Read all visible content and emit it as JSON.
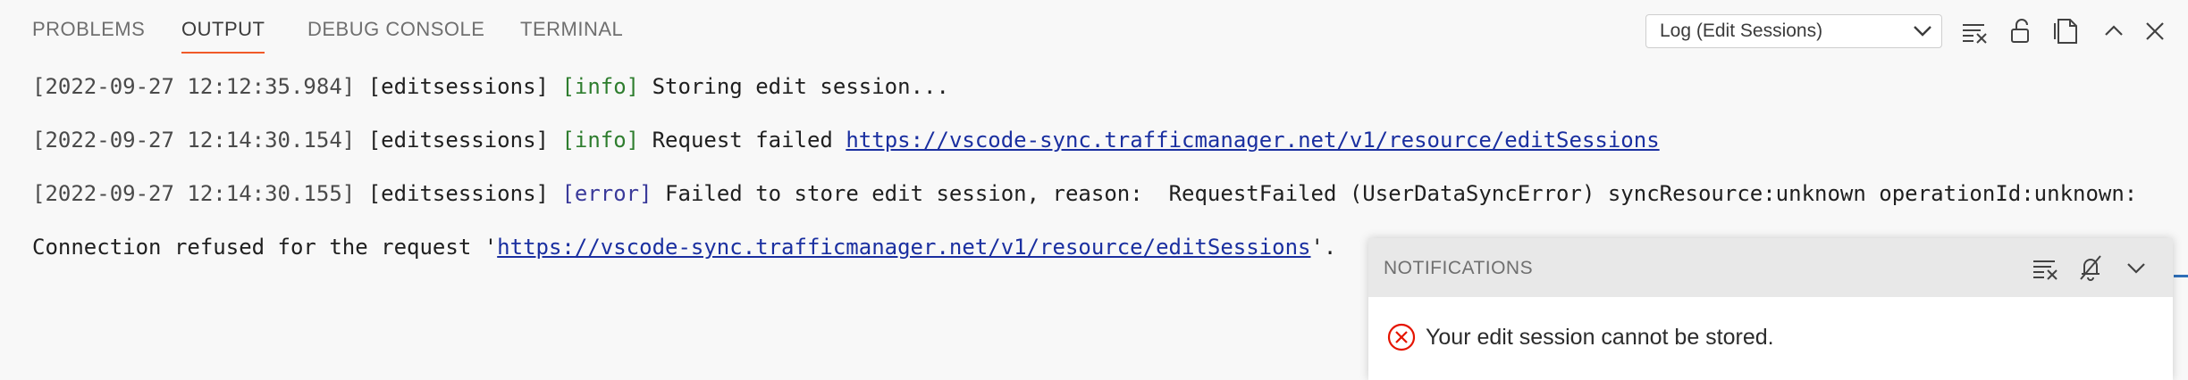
{
  "tabs": [
    {
      "label": "PROBLEMS",
      "active": false
    },
    {
      "label": "OUTPUT",
      "active": true
    },
    {
      "label": "DEBUG CONSOLE",
      "active": false
    },
    {
      "label": "TERMINAL",
      "active": false
    }
  ],
  "output_channel": {
    "selected": "Log (Edit Sessions)"
  },
  "toolbar_icons": [
    "clear-output-icon",
    "lock-scroll-icon",
    "open-in-editor-icon",
    "maximize-panel-icon",
    "close-panel-icon"
  ],
  "log": [
    {
      "timestamp": "[2022-09-27 12:12:35.984]",
      "source": "[editsessions]",
      "level": "[info]",
      "message": "Storing edit session..."
    },
    {
      "timestamp": "[2022-09-27 12:14:30.154]",
      "source": "[editsessions]",
      "level": "[info]",
      "message": "Request failed",
      "link": "https://vscode-sync.trafficmanager.net/v1/resource/editSessions"
    },
    {
      "timestamp": "[2022-09-27 12:14:30.155]",
      "source": "[editsessions]",
      "level": "[error]",
      "message": "Failed to store edit session, reason:  RequestFailed (UserDataSyncError) syncResource:unknown operationId:unknown:",
      "continuation_prefix": "Connection refused for the request '",
      "link": "https://vscode-sync.trafficmanager.net/v1/resource/editSessions",
      "continuation_suffix": "'."
    }
  ],
  "notifications": {
    "title": "NOTIFICATIONS",
    "icons": [
      "clear-all-icon",
      "do-not-disturb-icon",
      "collapse-icon"
    ],
    "items": [
      {
        "severity": "error",
        "message": "Your edit session cannot be stored."
      }
    ]
  },
  "colors": {
    "accent": "#f05a28",
    "info": "#2e7d2e",
    "error_level": "#3a3a9a",
    "link": "#1a2fa0",
    "error_icon": "#e51400"
  }
}
